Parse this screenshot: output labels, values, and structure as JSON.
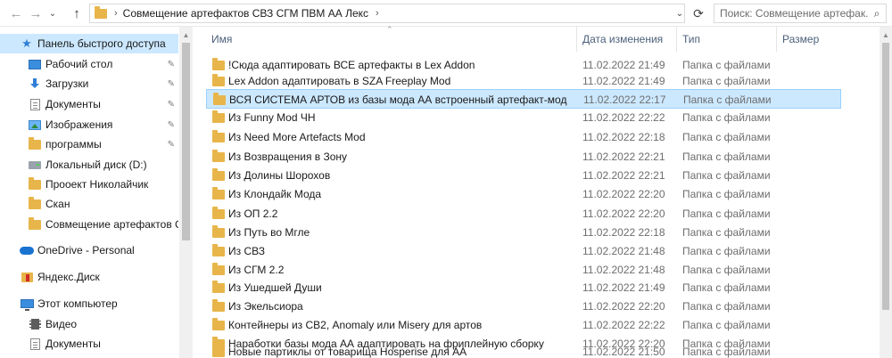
{
  "address_bar": {
    "path": "Совмещение артефактов СВЗ СГМ ПВМ АА Лекс",
    "search_placeholder": "Поиск: Совмещение артефак..."
  },
  "sidebar": {
    "items": [
      {
        "label": "Панель быстрого доступа",
        "icon": "star-icon",
        "pinned": false,
        "selected": true
      },
      {
        "label": "Рабочий стол",
        "icon": "desktop-icon",
        "pinned": true
      },
      {
        "label": "Загрузки",
        "icon": "download-icon",
        "pinned": true
      },
      {
        "label": "Документы",
        "icon": "documents-icon",
        "pinned": true
      },
      {
        "label": "Изображения",
        "icon": "pictures-icon",
        "pinned": true
      },
      {
        "label": "программы",
        "icon": "folder-icon",
        "pinned": true
      },
      {
        "label": "Локальный диск (D:)",
        "icon": "drive-icon",
        "pinned": false
      },
      {
        "label": "Прооект Николайчик",
        "icon": "folder-icon",
        "pinned": false
      },
      {
        "label": "Скан",
        "icon": "folder-icon",
        "pinned": false
      },
      {
        "label": "Совмещение артефактов СВЗ",
        "icon": "folder-icon",
        "pinned": false
      },
      {
        "label": "OneDrive - Personal",
        "icon": "onedrive-icon",
        "pinned": false
      },
      {
        "label": "Яндекс.Диск",
        "icon": "yandex-disk-icon",
        "pinned": false
      },
      {
        "label": "Этот компьютер",
        "icon": "computer-icon",
        "pinned": false
      },
      {
        "label": "Видео",
        "icon": "video-icon",
        "pinned": false
      },
      {
        "label": "Документы",
        "icon": "documents-icon",
        "pinned": false
      }
    ]
  },
  "columns": {
    "name": "Имя",
    "date": "Дата изменения",
    "type": "Тип",
    "size": "Размер"
  },
  "files": [
    {
      "name": "!Сюда адаптировать ВСЕ артефакты в Lex Addon",
      "date": "11.02.2022 21:49",
      "type": "Папка с файлами"
    },
    {
      "name": "Lex Addon адаптировать в SZA Freeplay Mod",
      "date": "11.02.2022 21:49",
      "type": "Папка с файлами"
    },
    {
      "name": "ВСЯ СИСТЕМА АРТОВ из базы мода АА встроенный артефакт-мод",
      "date": "11.02.2022 22:17",
      "type": "Папка с файлами",
      "selected": true
    },
    {
      "name": "Из Funny Mod ЧН",
      "date": "11.02.2022 22:22",
      "type": "Папка с файлами"
    },
    {
      "name": "Из Need More Artefacts Mod",
      "date": "11.02.2022 22:18",
      "type": "Папка с файлами"
    },
    {
      "name": "Из Возвращения в Зону",
      "date": "11.02.2022 22:21",
      "type": "Папка с файлами"
    },
    {
      "name": "Из Долины Шорохов",
      "date": "11.02.2022 22:21",
      "type": "Папка с файлами"
    },
    {
      "name": "Из Клондайк Мода",
      "date": "11.02.2022 22:20",
      "type": "Папка с файлами"
    },
    {
      "name": "Из ОП 2.2",
      "date": "11.02.2022 22:20",
      "type": "Папка с файлами"
    },
    {
      "name": "Из Путь во Мгле",
      "date": "11.02.2022 22:18",
      "type": "Папка с файлами"
    },
    {
      "name": "Из СВЗ",
      "date": "11.02.2022 21:48",
      "type": "Папка с файлами"
    },
    {
      "name": "Из СГМ 2.2",
      "date": "11.02.2022 21:48",
      "type": "Папка с файлами"
    },
    {
      "name": "Из Ушедшей Души",
      "date": "11.02.2022 21:49",
      "type": "Папка с файлами"
    },
    {
      "name": "Из Экельсиора",
      "date": "11.02.2022 22:20",
      "type": "Папка с файлами"
    },
    {
      "name": "Контейнеры из СВ2, Anomaly или Misery для артов",
      "date": "11.02.2022 22:22",
      "type": "Папка с файлами"
    },
    {
      "name": "Наработки базы мода АА адаптировать на фриплейную сборку",
      "date": "11.02.2022 22:20",
      "type": "Папка с файлами"
    },
    {
      "name": "Новые партиклы от товарища Hosperise для АА",
      "date": "11.02.2022 21:50",
      "type": "Папка с файлами"
    }
  ],
  "colors": {
    "selection": "#cce8ff",
    "folder": "#e8b54a",
    "header_text": "#4c607a"
  }
}
